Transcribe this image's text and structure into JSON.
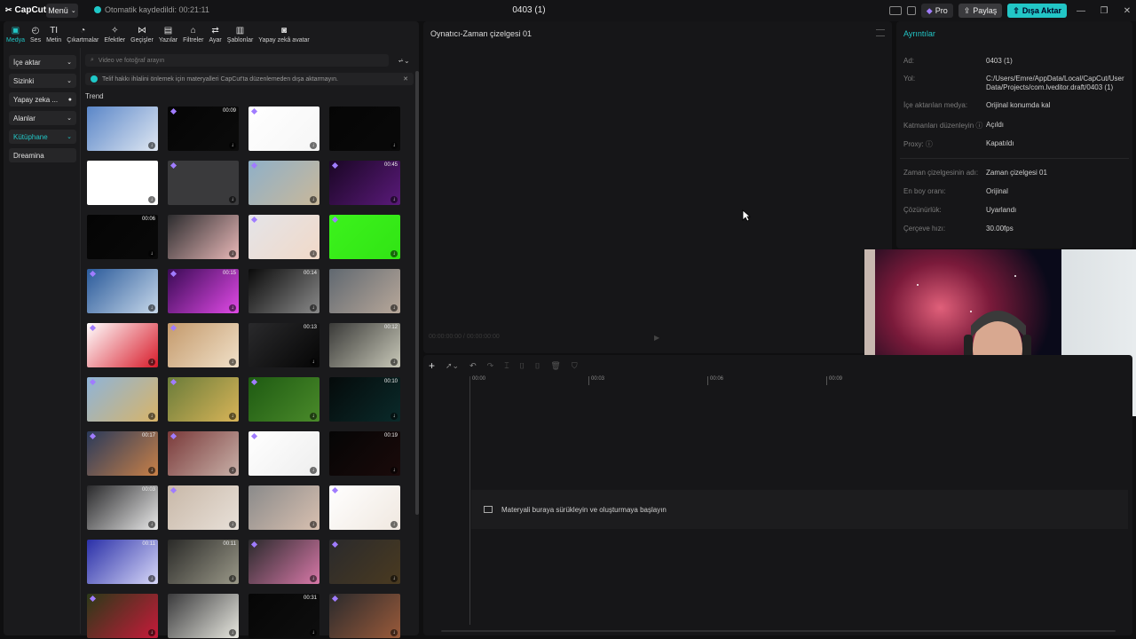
{
  "titlebar": {
    "logo": "CapCut",
    "menu": "Menü",
    "autosave": "Otomatik kaydedildi: 00:21:11",
    "project": "0403 (1)",
    "pro": "Pro",
    "share": "Paylaş",
    "export": "Dışa Aktar"
  },
  "toolbar": [
    {
      "label": "Medya",
      "icon": "▣",
      "active": true
    },
    {
      "label": "Ses",
      "icon": "◴"
    },
    {
      "label": "Metin",
      "icon": "TI"
    },
    {
      "label": "Çıkartmalar",
      "icon": "◔"
    },
    {
      "label": "Efektler",
      "icon": "✧"
    },
    {
      "label": "Geçişler",
      "icon": "⋈"
    },
    {
      "label": "Yazılar",
      "icon": "▤"
    },
    {
      "label": "Filtreler",
      "icon": "⌂"
    },
    {
      "label": "Ayar",
      "icon": "⇄"
    },
    {
      "label": "Şablonlar",
      "icon": "▥"
    },
    {
      "label": "Yapay zekâ avatar",
      "icon": "◙"
    }
  ],
  "sidebar": [
    {
      "label": "İçe aktar",
      "arrow": "⌄"
    },
    {
      "label": "Sizinki",
      "arrow": "⌄"
    },
    {
      "label": "Yapay zeka ...",
      "arrow": "●"
    },
    {
      "label": "Alanlar",
      "arrow": "⌄"
    },
    {
      "label": "Kütüphane",
      "arrow": "⌄",
      "teal": true
    },
    {
      "label": "Dreamina",
      "arrow": ""
    }
  ],
  "search": {
    "placeholder": "Video ve fotoğraf arayın"
  },
  "notice": "Telif hakkı ihlalini önlemek için materyalleri CapCut'ta düzenlemeden dışa aktarmayın.",
  "trend_label": "Trend",
  "thumbs": [
    {
      "dur": "",
      "gem": false,
      "colors": [
        "#5a86c8",
        "#dfe7f2"
      ]
    },
    {
      "dur": "00:09",
      "gem": true,
      "colors": [
        "#050505",
        "#0b0b0b"
      ]
    },
    {
      "dur": "",
      "gem": true,
      "colors": [
        "#ffffff",
        "#f6f6f6"
      ]
    },
    {
      "dur": "",
      "gem": false,
      "colors": [
        "#050505",
        "#090909"
      ]
    },
    {
      "dur": "",
      "gem": false,
      "colors": [
        "#ffffff",
        "#ffffff"
      ]
    },
    {
      "dur": "",
      "gem": true,
      "colors": [
        "#3a3a3c",
        "#3a3a3c"
      ]
    },
    {
      "dur": "",
      "gem": true,
      "colors": [
        "#8fb0c8",
        "#c9b89a"
      ]
    },
    {
      "dur": "00:45",
      "gem": true,
      "colors": [
        "#1a0624",
        "#5a1a7a"
      ]
    },
    {
      "dur": "00:06",
      "gem": false,
      "colors": [
        "#040404",
        "#090909"
      ]
    },
    {
      "dur": "",
      "gem": false,
      "colors": [
        "#2c2c2e",
        "#e9b8b8"
      ]
    },
    {
      "dur": "",
      "gem": true,
      "colors": [
        "#e4e4e8",
        "#f1d9c8"
      ]
    },
    {
      "dur": "",
      "gem": true,
      "colors": [
        "#3cf31c",
        "#31e414"
      ]
    },
    {
      "dur": "",
      "gem": true,
      "colors": [
        "#2a5a9a",
        "#c7d8ea"
      ]
    },
    {
      "dur": "00:15",
      "gem": true,
      "colors": [
        "#3a0a55",
        "#e04ae6"
      ]
    },
    {
      "dur": "00:14",
      "gem": false,
      "colors": [
        "#0a0a0a",
        "#8a8a8a"
      ]
    },
    {
      "dur": "",
      "gem": false,
      "colors": [
        "#606870",
        "#b8a89a"
      ]
    },
    {
      "dur": "",
      "gem": true,
      "colors": [
        "#ffffff",
        "#d81b2a"
      ]
    },
    {
      "dur": "",
      "gem": true,
      "colors": [
        "#c49a6c",
        "#f0e0c8"
      ]
    },
    {
      "dur": "00:13",
      "gem": false,
      "colors": [
        "#2a2a2c",
        "#050505"
      ]
    },
    {
      "dur": "00:12",
      "gem": false,
      "colors": [
        "#3a3a38",
        "#c8c8b8"
      ]
    },
    {
      "dur": "",
      "gem": true,
      "colors": [
        "#8fb4d8",
        "#d8b468"
      ]
    },
    {
      "dur": "",
      "gem": true,
      "colors": [
        "#6a7c3a",
        "#d8b458"
      ]
    },
    {
      "dur": "",
      "gem": true,
      "colors": [
        "#1e5a12",
        "#4a8a2a"
      ]
    },
    {
      "dur": "00:10",
      "gem": false,
      "colors": [
        "#050a0a",
        "#0a2a2a"
      ]
    },
    {
      "dur": "00:17",
      "gem": true,
      "colors": [
        "#2a3a5a",
        "#c88048"
      ]
    },
    {
      "dur": "",
      "gem": true,
      "colors": [
        "#7a3a3a",
        "#c8b0a8"
      ]
    },
    {
      "dur": "",
      "gem": true,
      "colors": [
        "#ffffff",
        "#eeeeee"
      ]
    },
    {
      "dur": "00:19",
      "gem": false,
      "colors": [
        "#050505",
        "#1a0a0a"
      ]
    },
    {
      "dur": "00:03",
      "gem": false,
      "colors": [
        "#2a2a2c",
        "#e8e8e8"
      ]
    },
    {
      "dur": "",
      "gem": true,
      "colors": [
        "#c8b8a8",
        "#e8e0d8"
      ]
    },
    {
      "dur": "",
      "gem": false,
      "colors": [
        "#8a8a8a",
        "#d8c0b0"
      ]
    },
    {
      "dur": "",
      "gem": true,
      "colors": [
        "#ffffff",
        "#f0e8e0"
      ]
    },
    {
      "dur": "00:11",
      "gem": false,
      "colors": [
        "#2a30a8",
        "#d8d8f8"
      ]
    },
    {
      "dur": "00:11",
      "gem": false,
      "colors": [
        "#2a2a28",
        "#9a9888"
      ]
    },
    {
      "dur": "",
      "gem": true,
      "colors": [
        "#2a2a2c",
        "#d878a8"
      ]
    },
    {
      "dur": "",
      "gem": true,
      "colors": [
        "#2a2a2c",
        "#4a3a20"
      ]
    },
    {
      "dur": "",
      "gem": true,
      "colors": [
        "#2a3a18",
        "#c81a3a"
      ]
    },
    {
      "dur": "",
      "gem": false,
      "colors": [
        "#3a3a3c",
        "#e8e8e0"
      ]
    },
    {
      "dur": "00:31",
      "gem": false,
      "colors": [
        "#060606",
        "#0e0e0e"
      ]
    },
    {
      "dur": "",
      "gem": true,
      "colors": [
        "#2a2a2c",
        "#9a5a3a"
      ]
    }
  ],
  "player": {
    "title": "Oynatıcı-Zaman çizelgesi 01",
    "timecode": "00:00:00:00 / 00:00:00:00"
  },
  "details": {
    "title": "Ayrıntılar",
    "rows": [
      {
        "label": "Ad:",
        "value": "0403 (1)"
      },
      {
        "label": "Yol:",
        "value": "C:/Users/Emre/AppData/Local/CapCut/User Data/Projects/com.lveditor.draft/0403 (1)"
      },
      {
        "label": "İçe aktarılan medya:",
        "value": "Orijinal konumda kal"
      },
      {
        "label": "Katmanları düzenleyin ⓘ",
        "value": "Açıldı"
      },
      {
        "label": "Proxy: ⓘ",
        "value": "Kapatıldı"
      },
      {
        "label": "Zaman çizelgesinin adı:",
        "value": "Zaman çizelgesi 01"
      },
      {
        "label": "En boy oranı:",
        "value": "Orijinal"
      },
      {
        "label": "Çözünürlük:",
        "value": "Uyarlandı"
      },
      {
        "label": "Çerçeve hızı:",
        "value": "30.00fps"
      }
    ]
  },
  "timeline": {
    "ticks": [
      "00:00",
      "00:03",
      "00:06",
      "00:09"
    ],
    "drop_hint": "Materyali buraya sürükleyin ve oluşturmaya başlayın"
  },
  "colors": {
    "accent": "#22c6c6",
    "bg": "#0f0f10",
    "panel": "#1a1a1c"
  }
}
